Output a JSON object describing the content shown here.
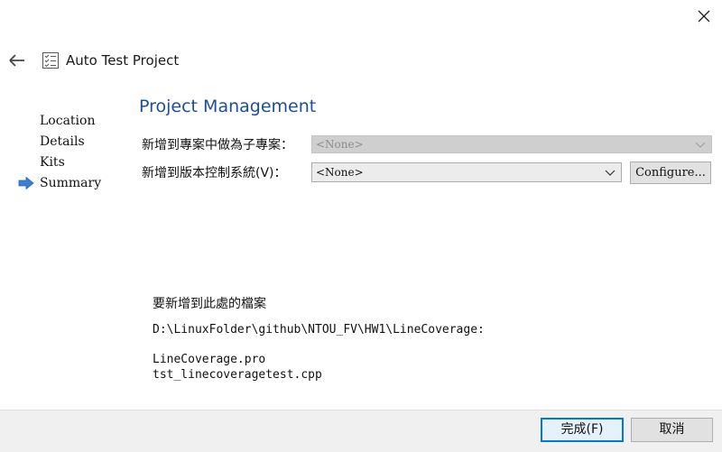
{
  "window": {
    "title": "Auto Test Project",
    "close_icon": "close-icon",
    "back_icon": "back-arrow-icon",
    "wizard_icon": "checklist-icon"
  },
  "steps": {
    "items": [
      {
        "label": "Location",
        "current": false
      },
      {
        "label": "Details",
        "current": false
      },
      {
        "label": "Kits",
        "current": false
      },
      {
        "label": "Summary",
        "current": true
      }
    ],
    "current_indicator_icon": "arrow-right-icon",
    "indicator_color": "#3c7fd4"
  },
  "main": {
    "title": "Project Management",
    "add_to_project_label": "新增到專案中做為子專案：",
    "add_to_project_value": "<None>",
    "add_to_vcs_label": "新增到版本控制系統(V)：",
    "add_to_vcs_value": "<None>",
    "configure_label": "Configure...",
    "accent_color": "#1a4f9c"
  },
  "summary": {
    "heading": "要新增到此處的檔案",
    "path": "D:\\LinuxFolder\\github\\NTOU_FV\\HW1\\LineCoverage:",
    "files": [
      "LineCoverage.pro",
      "tst_linecoveragetest.cpp"
    ]
  },
  "footer": {
    "finish_label": "完成(F)",
    "cancel_label": "取消"
  }
}
